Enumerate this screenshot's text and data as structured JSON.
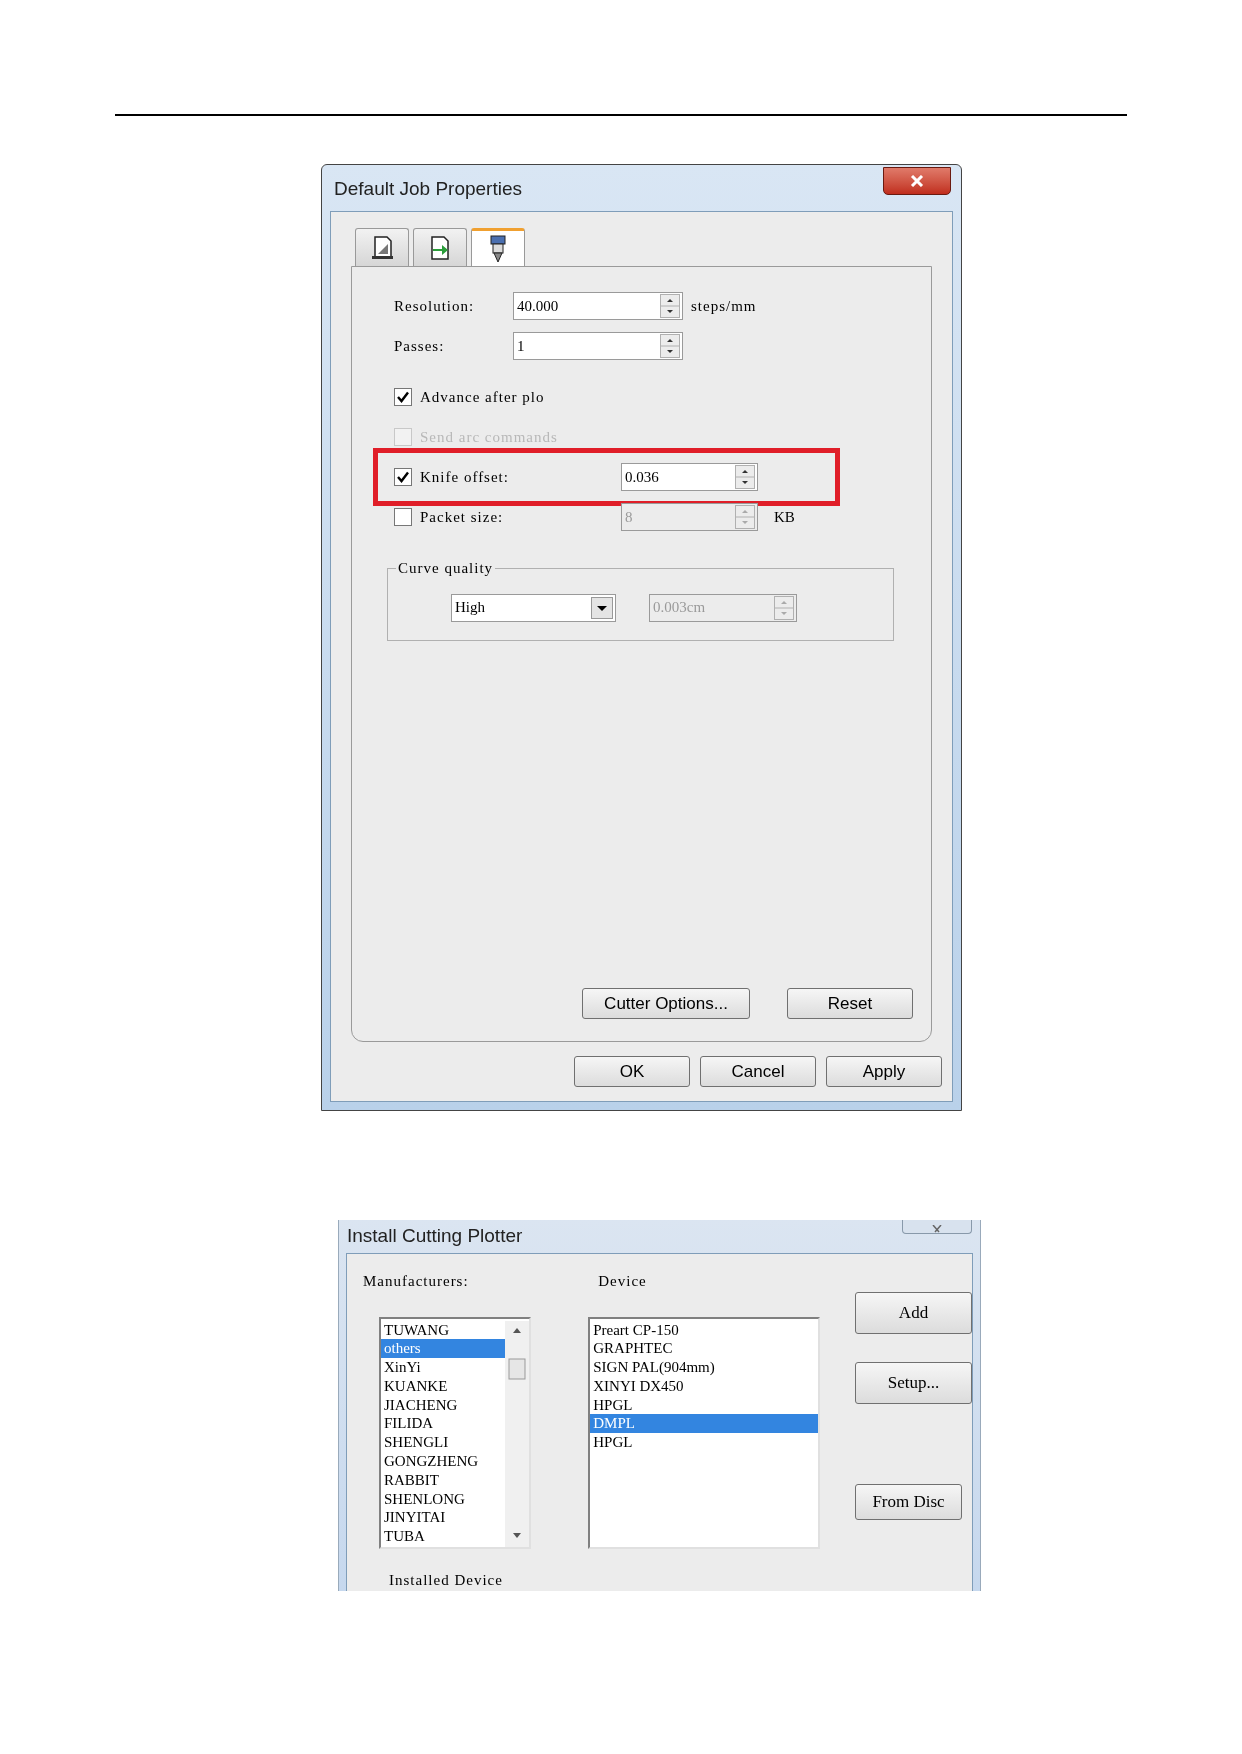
{
  "job_dialog": {
    "title": "Default Job Properties",
    "tabs": [
      {
        "kind": "page",
        "selected": false
      },
      {
        "kind": "transfer",
        "selected": false
      },
      {
        "kind": "knife",
        "selected": true
      }
    ],
    "resolution": {
      "label": "Resolution:",
      "value": "40.000",
      "unit": "steps/mm"
    },
    "passes": {
      "label": "Passes:",
      "value": "1"
    },
    "options": [
      {
        "label": "Advance after plo",
        "checked": true,
        "disabled": false,
        "highlighted": false
      },
      {
        "label": "Send arc commands",
        "checked": false,
        "disabled": true,
        "highlighted": false
      },
      {
        "label": "Knife offset:",
        "checked": true,
        "disabled": false,
        "highlighted": true,
        "value": "0.036",
        "value_disabled": false
      },
      {
        "label": "Packet size:",
        "checked": false,
        "disabled": false,
        "highlighted": false,
        "value": "8",
        "value_disabled": true,
        "unit": "KB"
      }
    ],
    "curve_quality": {
      "title": "Curve quality",
      "quality": "High",
      "step": "0.003cm",
      "step_disabled": true
    },
    "tab_buttons": [
      "Cutter Options...",
      "Reset"
    ],
    "buttons": [
      "OK",
      "Cancel",
      "Apply"
    ]
  },
  "plotter_dialog": {
    "title": "Install Cutting Plotter",
    "manufacturers_label": "Manufacturers:",
    "device_label": "Device",
    "manufacturers": [
      {
        "name": "TUWANG",
        "selected": false
      },
      {
        "name": "others",
        "selected": true
      },
      {
        "name": "XinYi",
        "selected": false
      },
      {
        "name": "KUANKE",
        "selected": false
      },
      {
        "name": "JIACHENG",
        "selected": false
      },
      {
        "name": "FILIDA",
        "selected": false
      },
      {
        "name": "SHENGLI",
        "selected": false
      },
      {
        "name": "GONGZHENG",
        "selected": false
      },
      {
        "name": "RABBIT",
        "selected": false
      },
      {
        "name": "SHENLONG",
        "selected": false
      },
      {
        "name": "JINYITAI",
        "selected": false
      },
      {
        "name": "TUBA",
        "selected": false
      }
    ],
    "devices": [
      {
        "name": "Preart CP-150",
        "selected": false
      },
      {
        "name": "GRAPHTEC",
        "selected": false
      },
      {
        "name": "SIGN PAL(904mm)",
        "selected": false
      },
      {
        "name": "XINYI DX450",
        "selected": false
      },
      {
        "name": "HPGL",
        "selected": false
      },
      {
        "name": "DMPL",
        "selected": true
      },
      {
        "name": "HPGL",
        "selected": false
      }
    ],
    "buttons": [
      "Add",
      "Setup...",
      "From Disc"
    ],
    "installed_label": "Installed Device"
  }
}
